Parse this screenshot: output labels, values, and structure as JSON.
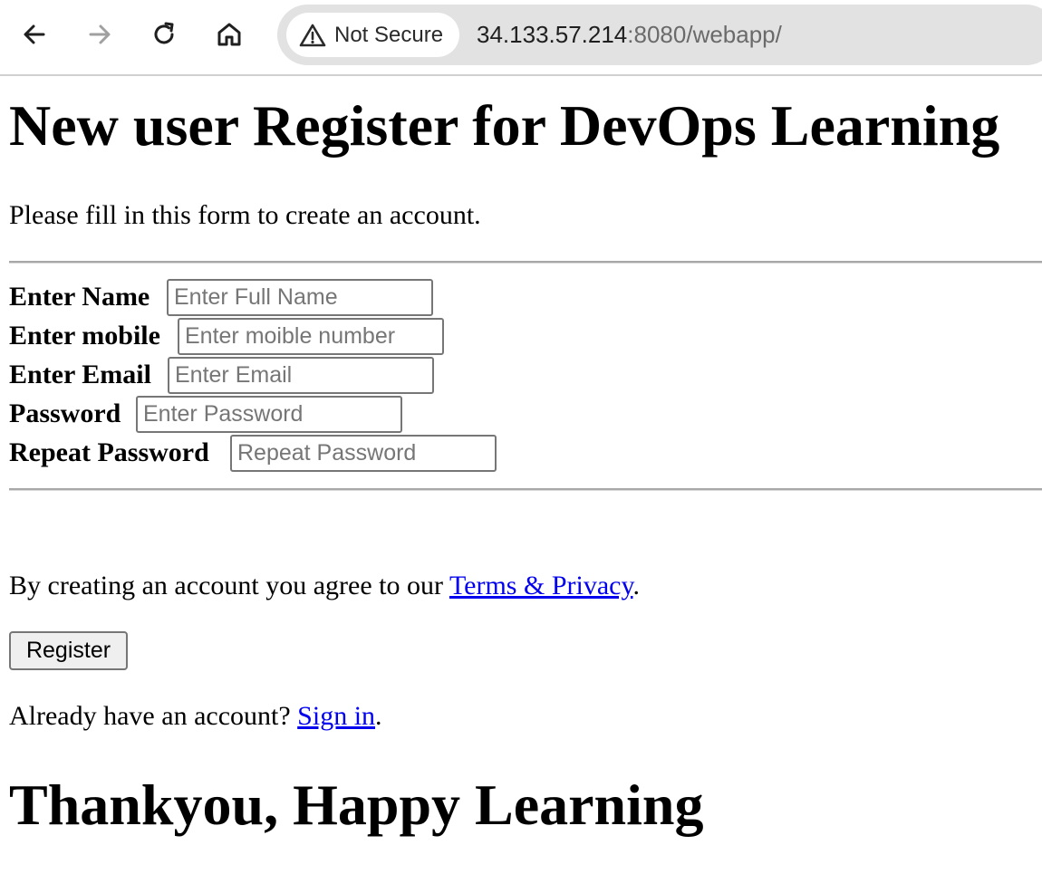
{
  "browser": {
    "security_chip_label": "Not Secure",
    "url_host": "34.133.57.214",
    "url_path": ":8080/webapp/",
    "icons": [
      "back-arrow-icon",
      "forward-arrow-icon",
      "reload-icon",
      "home-icon",
      "warning-triangle-icon"
    ]
  },
  "page": {
    "title": "New user Register for DevOps Learning",
    "intro": "Please fill in this form to create an account.",
    "fields": [
      {
        "label": "Enter Name",
        "placeholder": "Enter Full Name",
        "value": ""
      },
      {
        "label": "Enter mobile",
        "placeholder": "Enter moible number",
        "value": ""
      },
      {
        "label": "Enter Email",
        "placeholder": "Enter Email",
        "value": ""
      },
      {
        "label": "Password",
        "placeholder": "Enter Password",
        "value": ""
      },
      {
        "label": "Repeat Password",
        "placeholder": "Repeat Password",
        "value": ""
      }
    ],
    "terms_prefix": "By creating an account you agree to our ",
    "terms_link": "Terms & Privacy",
    "terms_suffix": ".",
    "register_button": "Register",
    "signin_prefix": "Already have an account? ",
    "signin_link": "Sign in",
    "signin_suffix": ".",
    "closing": "Thankyou, Happy Learning"
  },
  "colors": {
    "link": "#0000ee",
    "omnibox_background": "#e2e2e2",
    "disabled_icon": "#a0a0a0"
  }
}
